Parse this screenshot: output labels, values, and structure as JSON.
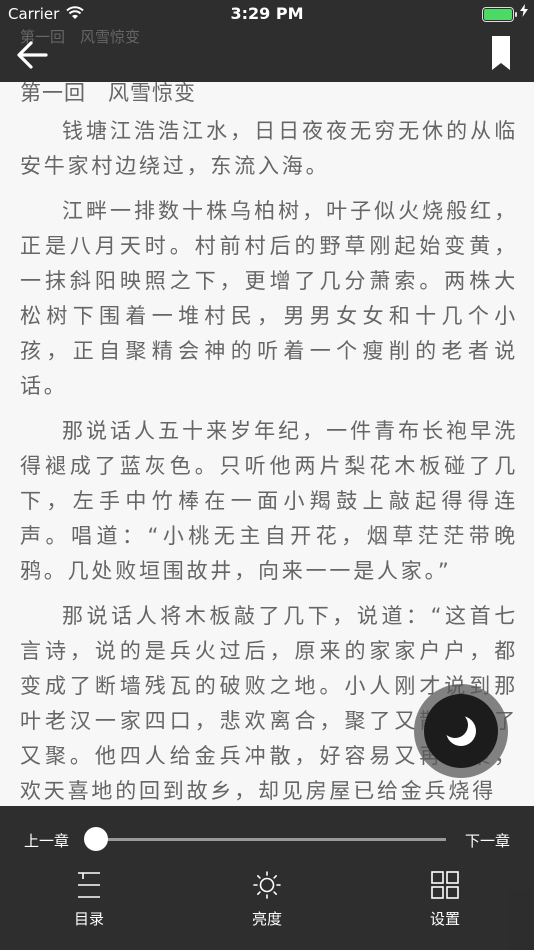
{
  "status": {
    "carrier": "Carrier",
    "time": "3:29 PM",
    "battery_level": 1.0,
    "battery_color": "#4cd964"
  },
  "nav": {
    "small_title": "第一回　风雪惊变",
    "back_icon": "back-arrow-icon",
    "bookmark_icon": "bookmark-icon"
  },
  "reader": {
    "chapter_title": "第一回　风雪惊变",
    "paragraphs": [
      "钱塘江浩浩江水，日日夜夜无穷无休的从临安牛家村边绕过，东流入海。",
      "江畔一排数十株乌柏树，叶子似火烧般红，正是八月天时。村前村后的野草刚起始变黄，一抹斜阳映照之下，更增了几分萧索。两株大松树下围着一堆村民，男男女女和十几个小孩，正自聚精会神的听着一个瘦削的老者说话。",
      "那说话人五十来岁年纪，一件青布长袍早洗得褪成了蓝灰色。只听他两片梨花木板碰了几下，左手中竹棒在一面小羯鼓上敲起得得连声。唱道：“小桃无主自开花，烟草茫茫带晚鸦。几处败垣围故井，向来一一是人家。”",
      "那说话人将木板敲了几下，说道：“这首七言诗，说的是兵火过后，原来的家家户户，都变成了断墙残瓦的破败之地。小人刚才说到那叶老汉一家四口，悲欢离合，聚了又散，散了又聚。他四人给金兵冲散，好容易又再团聚，欢天喜地的回到故乡，却见房屋已给金兵烧得"
    ]
  },
  "bottom": {
    "prev_chapter": "上一章",
    "next_chapter": "下一章",
    "progress": 0.0,
    "tools": [
      {
        "label": "目录",
        "icon": "menu-list-icon"
      },
      {
        "label": "亮度",
        "icon": "brightness-icon"
      },
      {
        "label": "设置",
        "icon": "settings-grid-icon"
      }
    ]
  },
  "night_mode_icon": "moon-icon"
}
